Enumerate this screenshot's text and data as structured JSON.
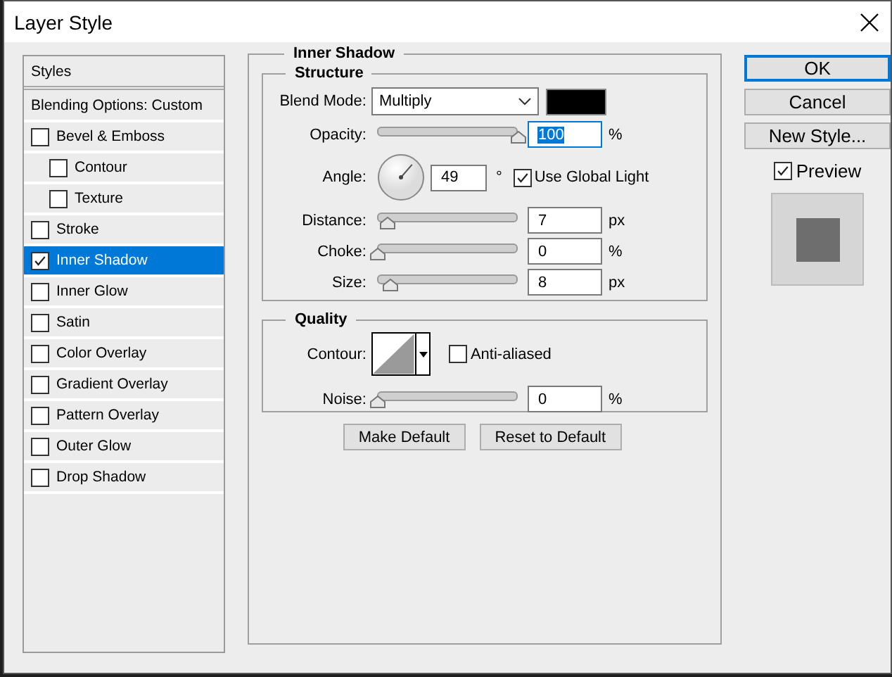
{
  "window": {
    "title": "Layer Style"
  },
  "styles": [
    {
      "kind": "header",
      "label": "Styles",
      "selected": false
    },
    {
      "kind": "header",
      "label": "Blending Options: Custom",
      "selected": false
    },
    {
      "kind": "checkbox",
      "label": "Bevel & Emboss",
      "checked": false,
      "selected": false,
      "children": [
        {
          "kind": "checkbox",
          "label": "Contour",
          "checked": false,
          "selected": false
        },
        {
          "kind": "checkbox",
          "label": "Texture",
          "checked": false,
          "selected": false
        }
      ]
    },
    {
      "kind": "checkbox",
      "label": "Stroke",
      "checked": false,
      "selected": false
    },
    {
      "kind": "checkbox",
      "label": "Inner Shadow",
      "checked": true,
      "selected": true
    },
    {
      "kind": "checkbox",
      "label": "Inner Glow",
      "checked": false,
      "selected": false
    },
    {
      "kind": "checkbox",
      "label": "Satin",
      "checked": false,
      "selected": false
    },
    {
      "kind": "checkbox",
      "label": "Color Overlay",
      "checked": false,
      "selected": false
    },
    {
      "kind": "checkbox",
      "label": "Gradient Overlay",
      "checked": false,
      "selected": false
    },
    {
      "kind": "checkbox",
      "label": "Pattern Overlay",
      "checked": false,
      "selected": false
    },
    {
      "kind": "checkbox",
      "label": "Outer Glow",
      "checked": false,
      "selected": false
    },
    {
      "kind": "checkbox",
      "label": "Drop Shadow",
      "checked": false,
      "selected": false
    }
  ],
  "panel": {
    "title": "Inner Shadow",
    "structure": {
      "title": "Structure",
      "blend_mode": {
        "label": "Blend Mode:",
        "value": "Multiply",
        "color": "#000000"
      },
      "opacity": {
        "label": "Opacity:",
        "level": 1,
        "value": "100",
        "unit": "%",
        "text_selected": true
      },
      "angle": {
        "label": "Angle:",
        "value": "49",
        "unit": "°",
        "global_light": {
          "label": "Use Global Light",
          "checked": true
        }
      },
      "sliders": [
        {
          "label": "Distance:",
          "level": 0.07,
          "value": "7",
          "unit": "px"
        },
        {
          "label": "Choke:",
          "level": 0,
          "value": "0",
          "unit": "%"
        },
        {
          "label": "Size:",
          "level": 0.09,
          "value": "8",
          "unit": "px"
        }
      ]
    },
    "quality": {
      "title": "Quality",
      "contour_label": "Contour:",
      "anti_aliased": {
        "label": "Anti-aliased",
        "checked": false
      },
      "noise": {
        "label": "Noise:",
        "level": 0,
        "value": "0",
        "unit": "%"
      }
    },
    "buttons": [
      "Make Default",
      "Reset to Default"
    ]
  },
  "actions": [
    {
      "label": "OK",
      "default": true
    },
    {
      "label": "Cancel",
      "default": false
    },
    {
      "label": "New Style...",
      "default": false
    }
  ],
  "preview": {
    "label": "Preview",
    "checked": true
  }
}
